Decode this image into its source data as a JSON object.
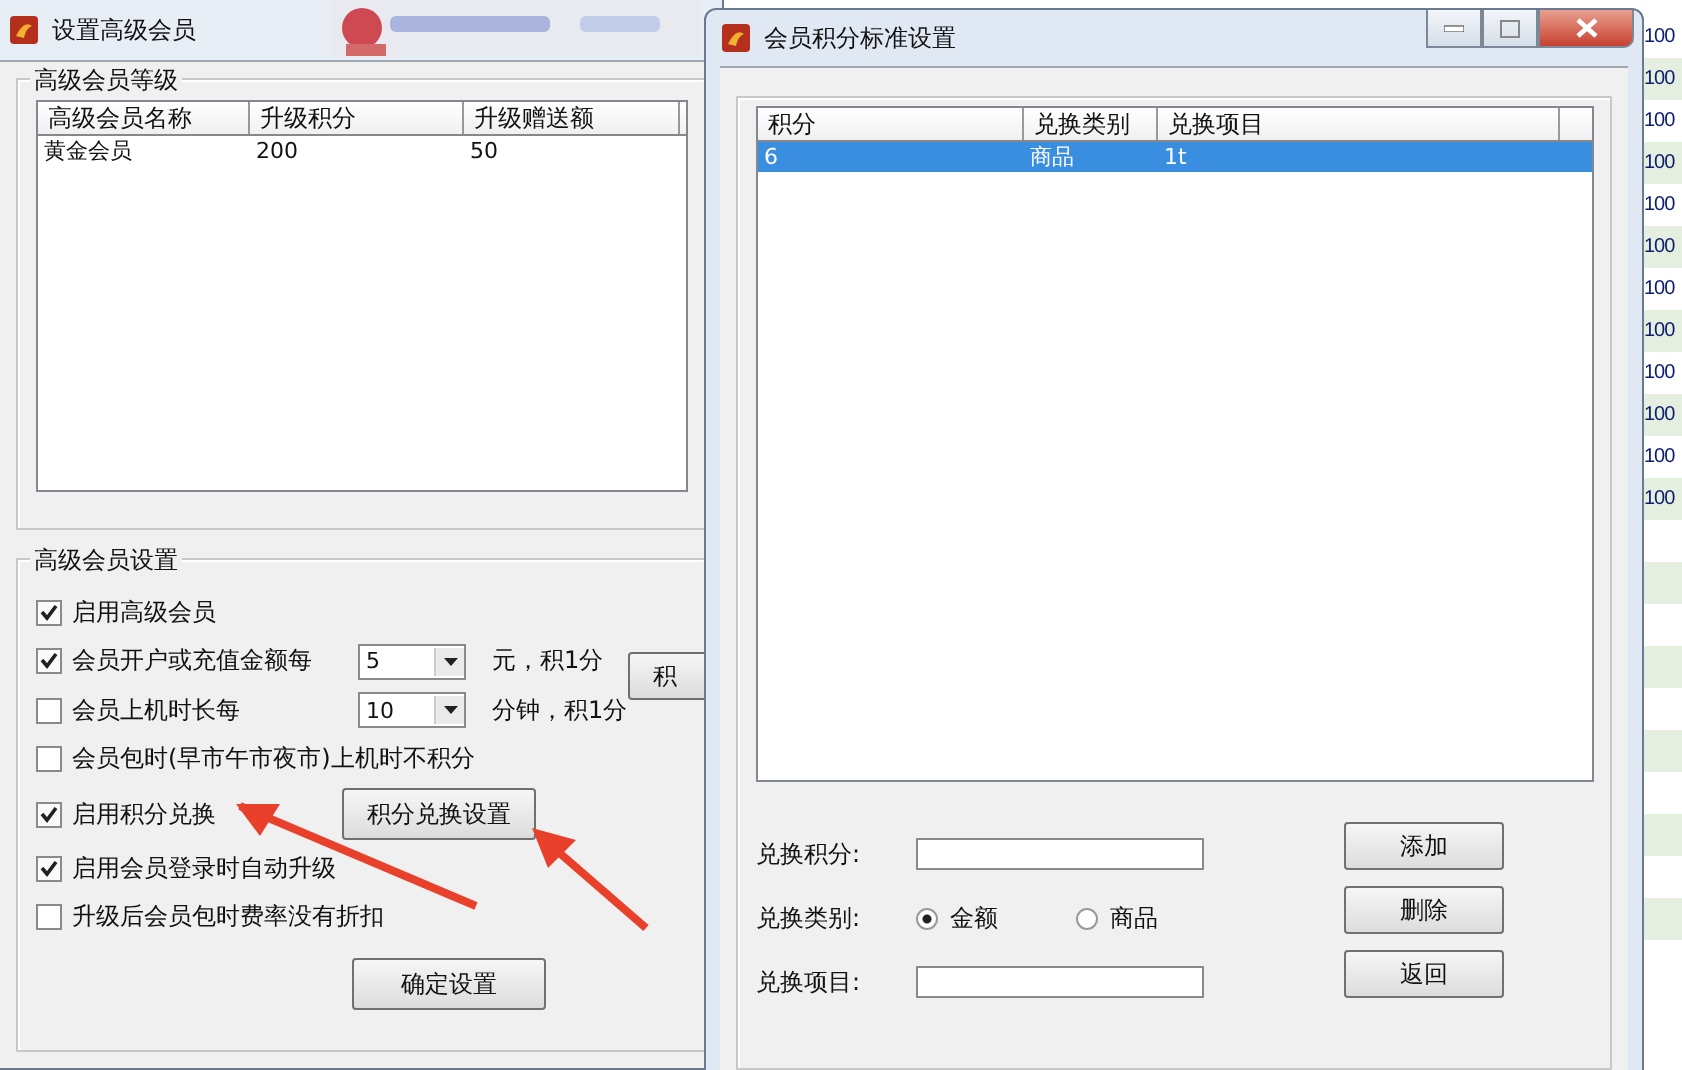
{
  "main_window": {
    "title": "设置高级会员",
    "levels_group": {
      "title": "高级会员等级",
      "columns": [
        "高级会员名称",
        "升级积分",
        "升级赠送额"
      ],
      "rows": [
        {
          "cells": [
            "黄金会员",
            "200",
            "50"
          ],
          "selected": false
        }
      ]
    },
    "settings_group": {
      "title": "高级会员设置",
      "items": [
        {
          "kind": "check",
          "label": "启用高级会员",
          "checked": true
        },
        {
          "kind": "check_select",
          "label": "会员开户或充值金额每",
          "checked": true,
          "value": "5",
          "unit": "元，积1分"
        },
        {
          "kind": "check_select",
          "label": "会员上机时长每",
          "checked": false,
          "value": "10",
          "unit": "分钟，积1分"
        },
        {
          "kind": "check",
          "label": "会员包时(早市午市夜市)上机时不积分",
          "checked": false
        },
        {
          "kind": "check_button",
          "label": "启用积分兑换",
          "checked": true,
          "button": "积分兑换设置"
        },
        {
          "kind": "check",
          "label": "启用会员登录时自动升级",
          "checked": true
        },
        {
          "kind": "check",
          "label": "升级后会员包时费率没有折扣",
          "checked": false
        }
      ],
      "side_button": "积",
      "confirm_button": "确定设置"
    }
  },
  "points_dialog": {
    "title": "会员积分标准设置",
    "columns": [
      "积分",
      "兑换类别",
      "兑换项目"
    ],
    "rows": [
      {
        "cells": [
          "6",
          "商品",
          "1t"
        ],
        "selected": true
      }
    ],
    "form": {
      "points_label": "兑换积分:",
      "type_label": "兑换类别:",
      "types": [
        {
          "label": "金额",
          "selected": true
        },
        {
          "label": "商品",
          "selected": false
        }
      ],
      "item_label": "兑换项目:"
    },
    "buttons": [
      "添加",
      "删除",
      "返回"
    ]
  },
  "background_list": [
    "100",
    "100",
    "100",
    "100",
    "100",
    "100",
    "100",
    "100",
    "100",
    "100",
    "100",
    "100"
  ]
}
